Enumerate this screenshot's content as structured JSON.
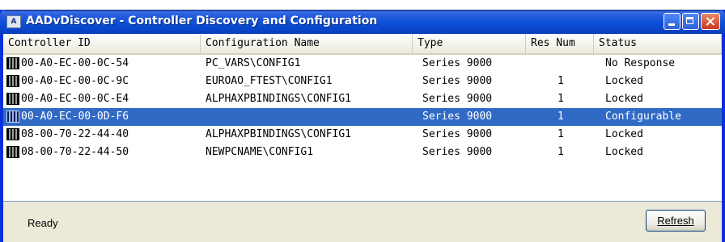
{
  "window": {
    "title": "AADvDiscover - Controller Discovery and Configuration",
    "app_icon_text": "A"
  },
  "columns": [
    "Controller ID",
    "Configuration Name",
    "Type",
    "Res Num",
    "Status"
  ],
  "rows": [
    {
      "id": "00-A0-EC-00-0C-54",
      "config": "PC_VARS\\CONFIG1",
      "type": "Series 9000",
      "res": "",
      "status": "No Response",
      "selected": false
    },
    {
      "id": "00-A0-EC-00-0C-9C",
      "config": "EUROAO_FTEST\\CONFIG1",
      "type": "Series 9000",
      "res": "1",
      "status": "Locked",
      "selected": false
    },
    {
      "id": "00-A0-EC-00-0C-E4",
      "config": "ALPHAXPBINDINGS\\CONFIG1",
      "type": "Series 9000",
      "res": "1",
      "status": "Locked",
      "selected": false
    },
    {
      "id": "00-A0-EC-00-0D-F6",
      "config": "",
      "type": "Series 9000",
      "res": "1",
      "status": "Configurable",
      "selected": true
    },
    {
      "id": "08-00-70-22-44-40",
      "config": "ALPHAXPBINDINGS\\CONFIG1",
      "type": "Series 9000",
      "res": "1",
      "status": "Locked",
      "selected": false
    },
    {
      "id": "08-00-70-22-44-50",
      "config": "NEWPCNAME\\CONFIG1",
      "type": "Series 9000",
      "res": "1",
      "status": "Locked",
      "selected": false
    }
  ],
  "status_bar": {
    "text": "Ready"
  },
  "buttons": {
    "refresh": "Refresh"
  },
  "colors": {
    "selection": "#316ac5",
    "titlebar": "#0b4fd8"
  }
}
